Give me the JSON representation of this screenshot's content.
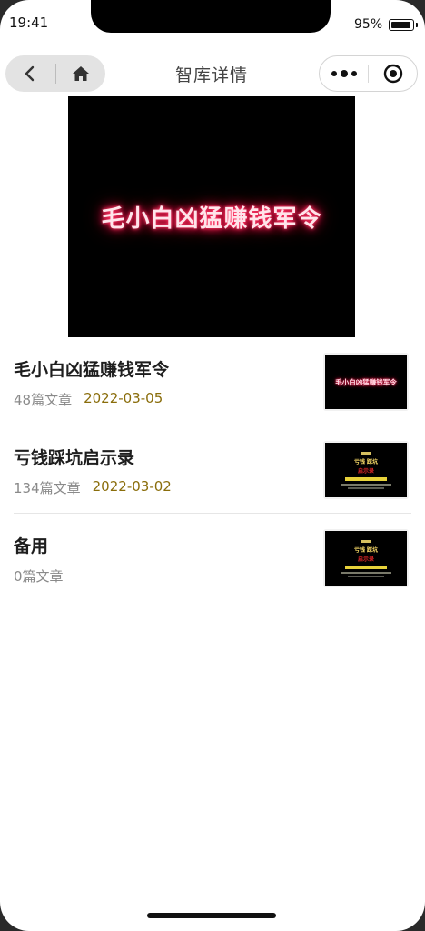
{
  "status_bar": {
    "time": "19:41",
    "battery": "95%"
  },
  "nav": {
    "title": "智库详情"
  },
  "banner": {
    "text": "毛小白凶猛赚钱军令"
  },
  "items": [
    {
      "title": "毛小白凶猛赚钱军令",
      "count": "48篇文章",
      "date": "2022-03-05",
      "thumb_text": "毛小白凶猛赚钱军令"
    },
    {
      "title": "亏钱踩坑启示录",
      "count": "134篇文章",
      "date": "2022-03-02",
      "thumb_main": "亏钱 踩坑",
      "thumb_sub": "启示录"
    },
    {
      "title": "备用",
      "count": "0篇文章",
      "date": "",
      "thumb_main": "亏钱 踩坑",
      "thumb_sub": "启示录"
    }
  ],
  "colors": {
    "date": "#8a6d0b",
    "count": "#8a8a8a",
    "neon": "#ff2255"
  }
}
